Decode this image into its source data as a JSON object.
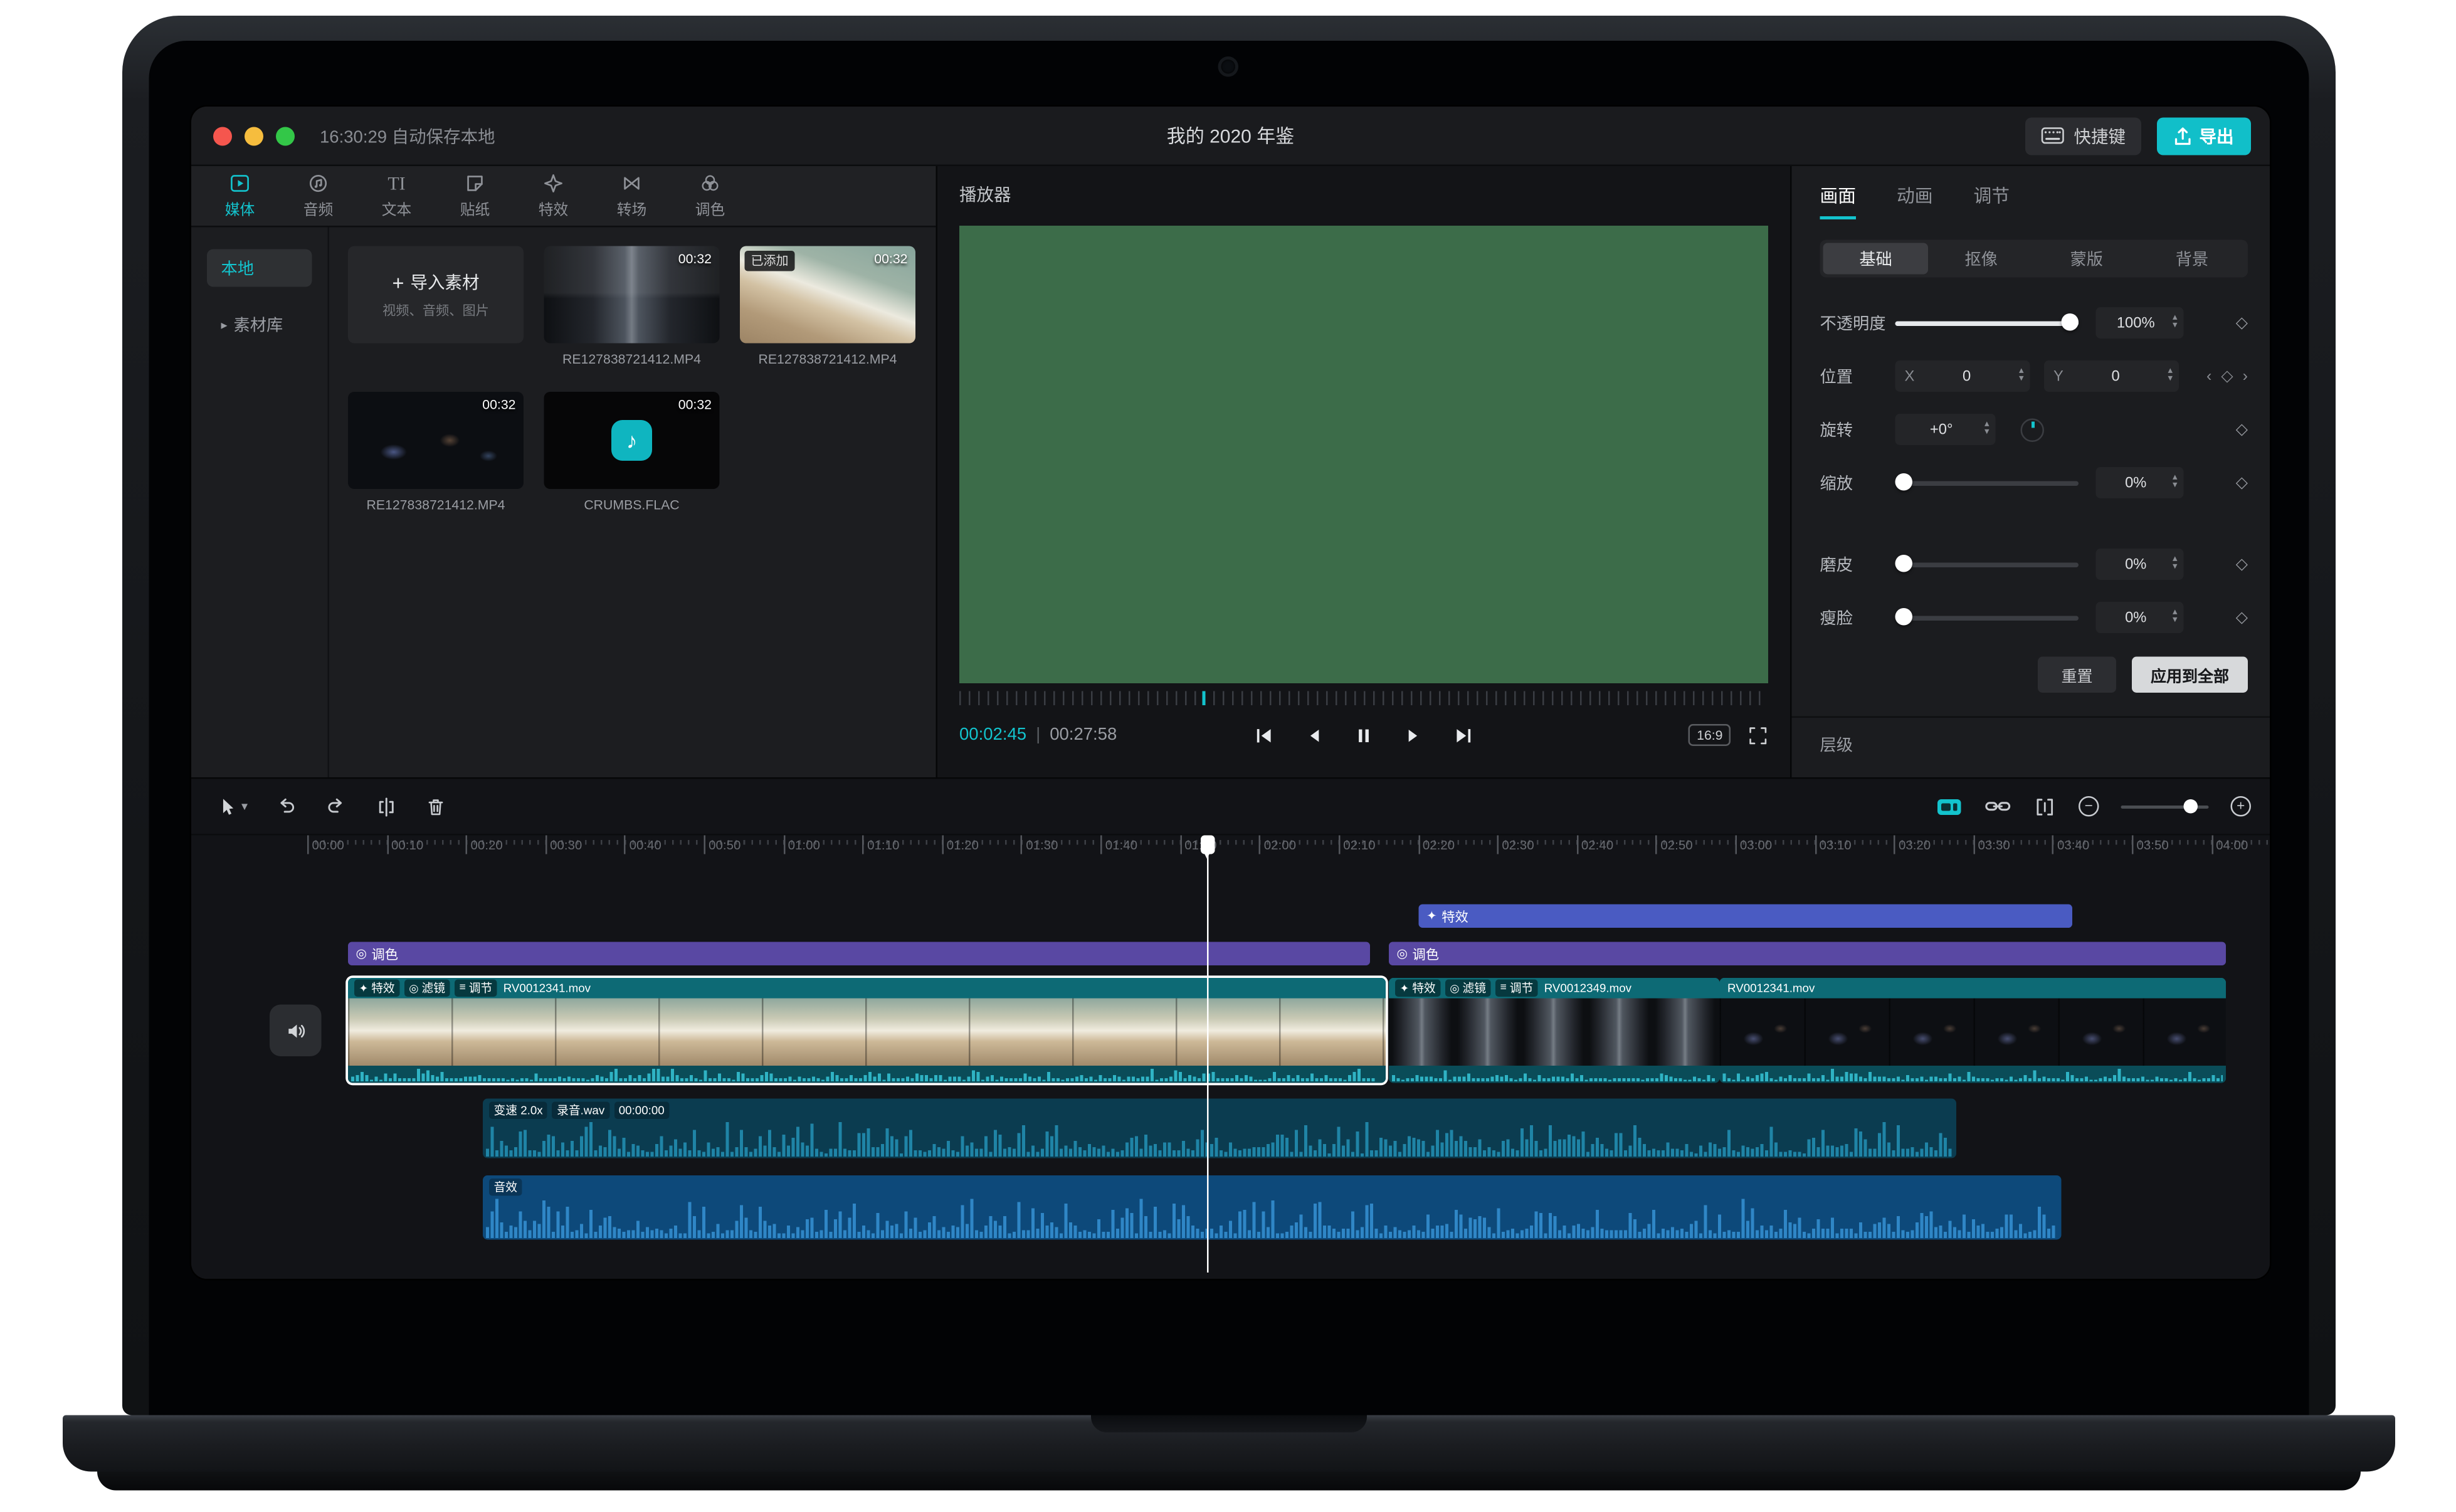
{
  "titlebar": {
    "autosave": "16:30:29 自动保存本地",
    "title": "我的 2020 年鉴",
    "shortcut_btn": "快捷键",
    "export_btn": "导出"
  },
  "media_panel": {
    "tabs": [
      {
        "label": "媒体"
      },
      {
        "label": "音频"
      },
      {
        "label": "文本"
      },
      {
        "label": "贴纸"
      },
      {
        "label": "特效"
      },
      {
        "label": "转场"
      },
      {
        "label": "调色"
      }
    ],
    "sidebar": [
      {
        "label": "本地"
      },
      {
        "label": "素材库"
      }
    ],
    "import_card": {
      "label": "导入素材",
      "hint": "视频、音频、图片"
    },
    "items": [
      {
        "duration": "00:32",
        "name": "RE127838721412.MP4"
      },
      {
        "duration": "00:32",
        "name": "RE127838721412.MP4",
        "badge": "已添加"
      },
      {
        "duration": "00:32",
        "name": "RE127838721412.MP4"
      },
      {
        "duration": "00:32",
        "name": "CRUMBS.FLAC"
      }
    ]
  },
  "player": {
    "title": "播放器",
    "current_time": "00:02:45",
    "total_time": "00:27:58",
    "aspect": "16:9"
  },
  "properties": {
    "tabs": [
      {
        "label": "画面"
      },
      {
        "label": "动画"
      },
      {
        "label": "调节"
      }
    ],
    "subtabs": [
      {
        "label": "基础"
      },
      {
        "label": "抠像"
      },
      {
        "label": "蒙版"
      },
      {
        "label": "背景"
      }
    ],
    "opacity": {
      "label": "不透明度",
      "value": "100%"
    },
    "position": {
      "label": "位置",
      "x_label": "X",
      "x": "0",
      "y_label": "Y",
      "y": "0"
    },
    "rotation": {
      "label": "旋转",
      "value": "+0°"
    },
    "scale": {
      "label": "缩放",
      "value": "0%"
    },
    "smooth": {
      "label": "磨皮",
      "value": "0%"
    },
    "slim": {
      "label": "瘦脸",
      "value": "0%"
    },
    "reset_btn": "重置",
    "apply_all_btn": "应用到全部",
    "layer_label": "层级"
  },
  "timeline": {
    "ruler": [
      "00:00",
      "00:10",
      "00:20",
      "00:30",
      "00:40",
      "00:50",
      "01:00",
      "01:10",
      "01:20",
      "01:30",
      "01:40",
      "01:50",
      "02:00",
      "02:10",
      "02:20",
      "02:30",
      "02:40",
      "02:50",
      "03:00",
      "03:10",
      "03:20",
      "03:30",
      "03:40",
      "03:50",
      "04:00"
    ],
    "effect_clip": {
      "label": "特效"
    },
    "color_clips": [
      {
        "label": "调色"
      },
      {
        "label": "调色"
      }
    ],
    "video_clips": [
      {
        "chips": [
          "特效",
          "滤镜",
          "调节"
        ],
        "name": "RV0012341.mov"
      },
      {
        "chips": [
          "特效",
          "滤镜",
          "调节"
        ],
        "name": "RV0012349.mov"
      },
      {
        "chips": [],
        "name": "RV0012341.mov"
      }
    ],
    "audio_clips": [
      {
        "chips": [
          "变速 2.0x",
          "录音.wav",
          "00:00:00"
        ]
      },
      {
        "chips": [
          "音效"
        ]
      }
    ]
  },
  "icons": {
    "effect": "✦",
    "filter": "◎",
    "adjust": "≡",
    "caret": "▸",
    "stepper_up": "▴",
    "stepper_down": "▾",
    "diamond": "◇",
    "kf_prev": "‹",
    "kf_next": "›",
    "plus": "+",
    "minus": "−",
    "note": "♪",
    "text_tool": "TI",
    "divider": "|"
  },
  "colors": {
    "accent": "#13c3cd",
    "export_button": "#11bfc9",
    "preview_green": "#3c6c49",
    "effect_track": "#4a5bc2",
    "color_track": "#5948a3",
    "video_header": "#0d6a75",
    "audio1_bg": "#0b3c50",
    "audio2_bg": "#0d497a"
  }
}
